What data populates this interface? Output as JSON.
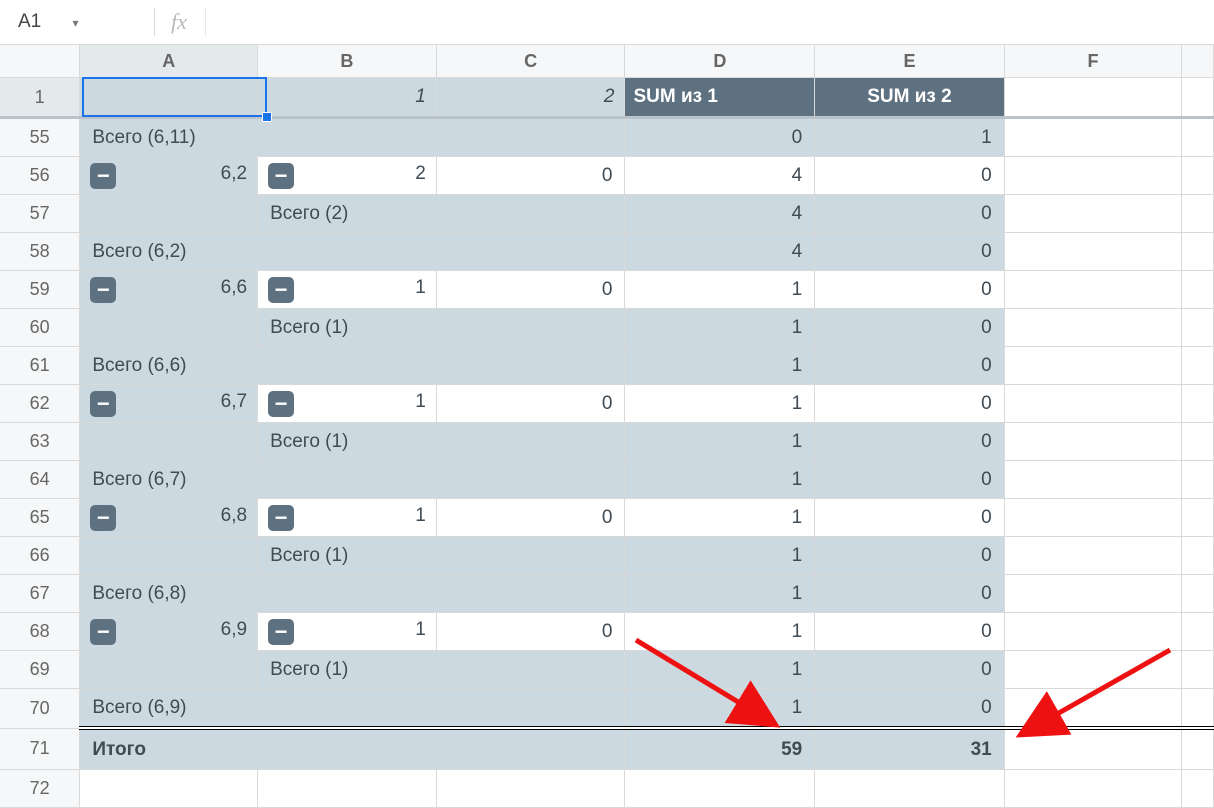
{
  "namebox": {
    "value": "A1",
    "dropdown_glyph": "▾"
  },
  "columns": [
    "A",
    "B",
    "C",
    "D",
    "E",
    "F"
  ],
  "header_row": {
    "num": "1",
    "b_label": "1",
    "c_label": "2",
    "d_label": "SUM из 1",
    "e_label": "SUM из 2"
  },
  "rows": [
    {
      "n": "55",
      "type": "total_a",
      "a": "Всего (6,11)",
      "d": "0",
      "e": "1"
    },
    {
      "n": "56",
      "type": "data",
      "a_val": "6,2",
      "b_val": "2",
      "c_val": "0",
      "d": "4",
      "e": "0"
    },
    {
      "n": "57",
      "type": "total_b",
      "b": "Всего (2)",
      "d": "4",
      "e": "0"
    },
    {
      "n": "58",
      "type": "total_a",
      "a": "Всего (6,2)",
      "d": "4",
      "e": "0"
    },
    {
      "n": "59",
      "type": "data",
      "a_val": "6,6",
      "b_val": "1",
      "c_val": "0",
      "d": "1",
      "e": "0"
    },
    {
      "n": "60",
      "type": "total_b",
      "b": "Всего (1)",
      "d": "1",
      "e": "0"
    },
    {
      "n": "61",
      "type": "total_a",
      "a": "Всего (6,6)",
      "d": "1",
      "e": "0"
    },
    {
      "n": "62",
      "type": "data",
      "a_val": "6,7",
      "b_val": "1",
      "c_val": "0",
      "d": "1",
      "e": "0"
    },
    {
      "n": "63",
      "type": "total_b",
      "b": "Всего (1)",
      "d": "1",
      "e": "0"
    },
    {
      "n": "64",
      "type": "total_a",
      "a": "Всего (6,7)",
      "d": "1",
      "e": "0"
    },
    {
      "n": "65",
      "type": "data",
      "a_val": "6,8",
      "b_val": "1",
      "c_val": "0",
      "d": "1",
      "e": "0"
    },
    {
      "n": "66",
      "type": "total_b",
      "b": "Всего (1)",
      "d": "1",
      "e": "0"
    },
    {
      "n": "67",
      "type": "total_a",
      "a": "Всего (6,8)",
      "d": "1",
      "e": "0"
    },
    {
      "n": "68",
      "type": "data",
      "a_val": "6,9",
      "b_val": "1",
      "c_val": "0",
      "d": "1",
      "e": "0"
    },
    {
      "n": "69",
      "type": "total_b",
      "b": "Всего (1)",
      "d": "1",
      "e": "0"
    },
    {
      "n": "70",
      "type": "total_a",
      "a": "Всего (6,9)",
      "d": "1",
      "e": "0"
    },
    {
      "n": "71",
      "type": "grand",
      "a": "Итого",
      "d": "59",
      "e": "31"
    },
    {
      "n": "72",
      "type": "empty"
    }
  ]
}
